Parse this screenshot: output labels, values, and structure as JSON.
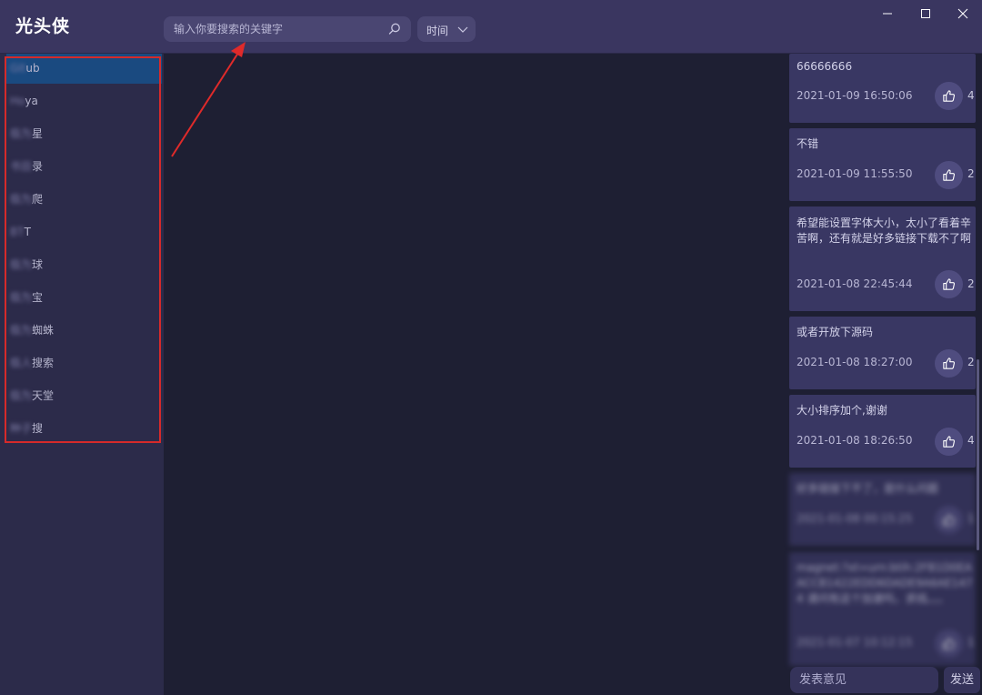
{
  "app": {
    "title": "光头侠"
  },
  "search": {
    "placeholder": "输入你要搜索的关键字"
  },
  "sort": {
    "selected": "时间"
  },
  "sidebar": {
    "items": [
      {
        "blurred": "Git",
        "label": "ub"
      },
      {
        "blurred": "Ho",
        "label": "ya"
      },
      {
        "blurred": "极为",
        "label": "星"
      },
      {
        "blurred": "书目",
        "label": "录"
      },
      {
        "blurred": "极为",
        "label": "爬"
      },
      {
        "blurred": "BT",
        "label": "T"
      },
      {
        "blurred": "极为",
        "label": "球"
      },
      {
        "blurred": "极为",
        "label": "宝"
      },
      {
        "blurred": "极为",
        "label": "蜘蛛"
      },
      {
        "blurred": "极人",
        "label": "搜索"
      },
      {
        "blurred": "极为",
        "label": "天堂"
      },
      {
        "blurred": "种子",
        "label": "搜"
      }
    ]
  },
  "comments": [
    {
      "text": "66666666",
      "date": "2021-01-09 16:50:06",
      "likes": "4"
    },
    {
      "text": "不错",
      "date": "2021-01-09 11:55:50",
      "likes": "2"
    },
    {
      "text": "希望能设置字体大小，太小了看着辛苦啊，还有就是好多链接下载不了啊",
      "date": "2021-01-08 22:45:44",
      "likes": "2"
    },
    {
      "text": "或者开放下源码",
      "date": "2021-01-08 18:27:00",
      "likes": "2"
    },
    {
      "text": "大小排序加个,谢谢",
      "date": "2021-01-08 18:26:50",
      "likes": "4"
    },
    {
      "text": "好多链接下不了，是什么问题",
      "date": "2021-01-08 00:15:25",
      "likes": "1"
    },
    {
      "text": "magnet:?xt=urn:btih:2FB1D0EAACCB1422EDD6DADE9A6AE1474 请问有这个加速吗，求线。。。",
      "date": "2021-01-07 10:12:15",
      "likes": "1"
    }
  ],
  "feedback": {
    "placeholder": "发表意见",
    "send_label": "发送"
  },
  "colors": {
    "highlight": "#d62a2a",
    "active_item": "#1a4a80",
    "card": "#393763"
  }
}
